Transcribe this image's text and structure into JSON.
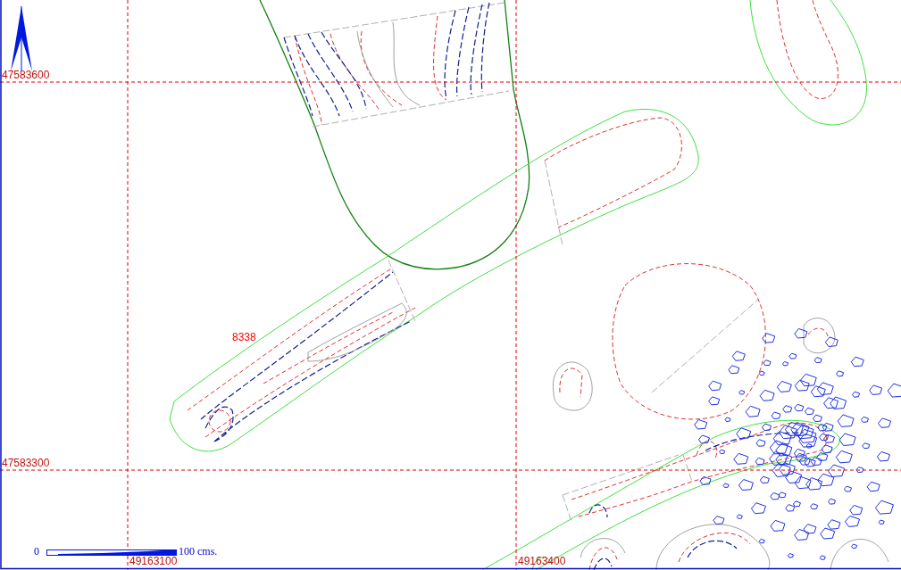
{
  "northings": [
    "47583600",
    "47583300"
  ],
  "eastings": [
    "49163100",
    "49163400"
  ],
  "feature_labels": [
    "8338"
  ],
  "scale_bar": {
    "start": "0",
    "end": "100 cms."
  }
}
